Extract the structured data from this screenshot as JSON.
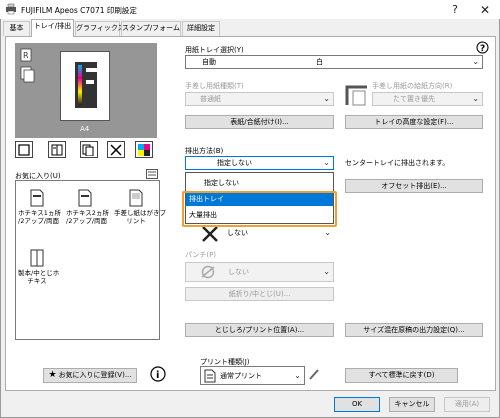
{
  "window": {
    "title": "FUJIFILM Apeos C7071 印刷設定"
  },
  "tabs": [
    "基本",
    "トレイ/排出",
    "グラフィックス",
    "スタンプ/フォーム",
    "詳細設定"
  ],
  "preview": {
    "caption": "A4"
  },
  "favorites": {
    "label": "お気に入り(U)",
    "items": [
      "ホチキス1ヵ所\n/2アップ/両面",
      "ホチキス2ヵ所\n/2アップ/両面",
      "手差し紙はがきプ\nリント",
      "製本/中とじホ\nチキス"
    ],
    "register_button": "お気に入りに登録(V)..."
  },
  "paper_tray": {
    "label": "用紙トレイ選択(Y)",
    "value_left": "自動",
    "value_mid": "白",
    "manual_type_label": "手差し用紙種類(T)",
    "manual_type_value": "普通紙",
    "orientation_label": "手差し用紙の給紙方向(R)",
    "orientation_value": "たて置き優先",
    "cover_button": "表紙/合紙付け(I)...",
    "advanced_button": "トレイの高度な設定(F)..."
  },
  "output": {
    "label": "排出方法(B)",
    "value": "指定しない",
    "note": "センタートレイに排出されます。",
    "offset_button": "オフセット排出(E)...",
    "options": [
      "指定しない",
      "排出トレイ",
      "大量排出"
    ],
    "selected_index": 1
  },
  "staple": {
    "value": "しない"
  },
  "punch": {
    "label": "パンチ(P)",
    "value": "しない"
  },
  "fold_button": "紙折り/中とじ(U)...",
  "margin_button": "とじしろ/プリント位置(A)...",
  "size_mix_button": "サイズ混在原稿の出力設定(Q)...",
  "print_type": {
    "label": "プリント種類(J)",
    "value": "通常プリント"
  },
  "reset_button": "すべて標準に戻す(D)",
  "footer": {
    "ok": "OK",
    "cancel": "キャンセル",
    "apply": "適用(A)"
  },
  "colors": {
    "accent": "#0078d7",
    "highlight_border": "#f0a030"
  }
}
